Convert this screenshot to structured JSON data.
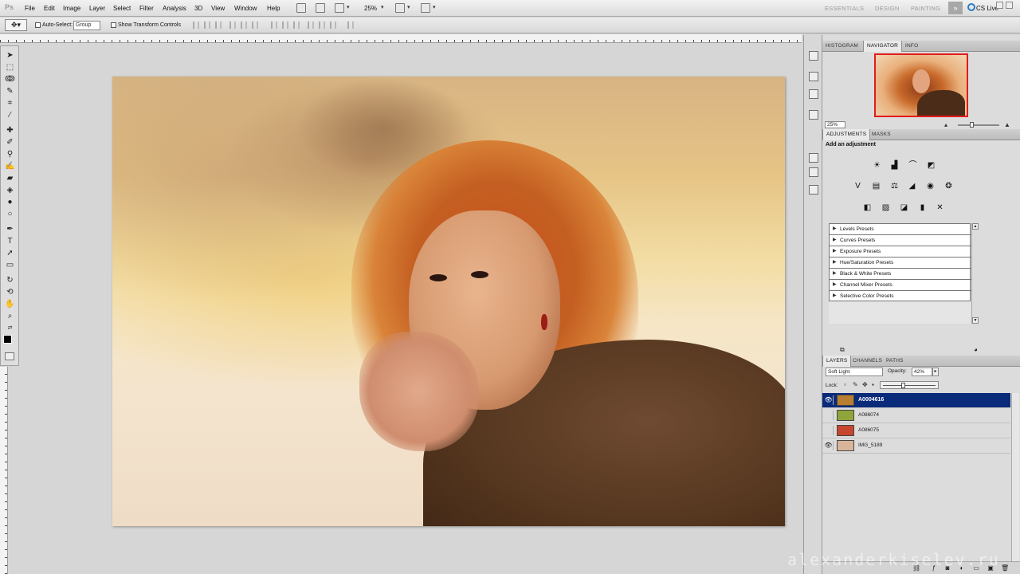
{
  "app": {
    "logo": "Ps"
  },
  "menu": [
    "File",
    "Edit",
    "Image",
    "Layer",
    "Select",
    "Filter",
    "Analysis",
    "3D",
    "View",
    "Window",
    "Help"
  ],
  "appbar": {
    "zoom": "25%",
    "workspaces": [
      "ESSENTIALS",
      "DESIGN",
      "PAINTING"
    ],
    "more": "»",
    "cslive": "CS Live"
  },
  "options": {
    "auto_select_label": "Auto-Select:",
    "auto_select_value": "Group",
    "transform_label": "Show Transform Controls"
  },
  "navigator": {
    "tabs": [
      "HISTOGRAM",
      "NAVIGATOR",
      "INFO"
    ],
    "active": "NAVIGATOR",
    "zoom": "25%"
  },
  "adjustments": {
    "tabs": [
      "ADJUSTMENTS",
      "MASKS"
    ],
    "title": "Add an adjustment",
    "icons_row1": [
      "brightness-contrast-icon",
      "levels-icon",
      "curves-icon",
      "exposure-icon"
    ],
    "icons_row2": [
      "vibrance-icon",
      "hue-saturation-icon",
      "color-balance-icon",
      "black-white-icon",
      "photo-filter-icon",
      "channel-mixer-icon"
    ],
    "icons_row3": [
      "invert-icon",
      "posterize-icon",
      "threshold-icon",
      "gradient-map-icon",
      "selective-color-icon"
    ],
    "presets": [
      "Levels Presets",
      "Curves Presets",
      "Exposure Presets",
      "Hue/Saturation Presets",
      "Black & White Presets",
      "Channel Mixer Presets",
      "Selective Color Presets"
    ]
  },
  "layers": {
    "tabs": [
      "LAYERS",
      "CHANNELS",
      "PATHS"
    ],
    "blend_mode": "Soft Light",
    "opacity_label": "Opacity:",
    "opacity": "42%",
    "lock_label": "Lock:",
    "items": [
      {
        "name": "A0004616",
        "visible": true,
        "selected": true,
        "thumb": "#b77f2f"
      },
      {
        "name": "A086074",
        "visible": false,
        "selected": false,
        "thumb": "#8fa43b"
      },
      {
        "name": "A086075",
        "visible": false,
        "selected": false,
        "thumb": "#c6472e"
      },
      {
        "name": "IMG_5189",
        "visible": true,
        "selected": false,
        "thumb": "#d9b49a"
      }
    ]
  },
  "watermark": "alexanderkiselev.ru"
}
